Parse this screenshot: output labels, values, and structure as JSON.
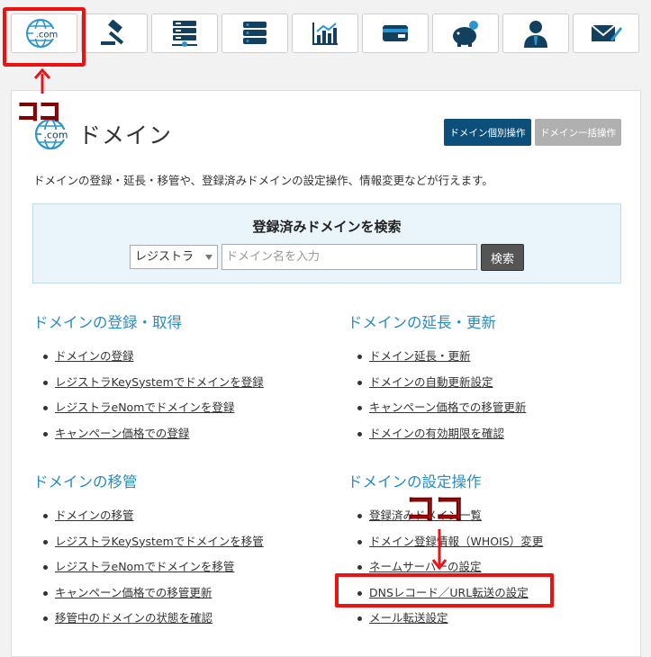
{
  "tabs": [
    {
      "name": "domain-tab",
      "icon": "dotcom-globe-icon"
    },
    {
      "name": "auction-tab",
      "icon": "gavel-icon"
    },
    {
      "name": "server-tab",
      "icon": "server-icon"
    },
    {
      "name": "storage-tab",
      "icon": "storage-stack-icon"
    },
    {
      "name": "analytics-tab",
      "icon": "chart-icon"
    },
    {
      "name": "payment-tab",
      "icon": "card-icon"
    },
    {
      "name": "points-tab",
      "icon": "piggy-bank-icon"
    },
    {
      "name": "account-tab",
      "icon": "person-icon"
    },
    {
      "name": "mail-tab",
      "icon": "mail-icon"
    }
  ],
  "tab_globe_label": ".com",
  "annotations": {
    "koko": "ココ"
  },
  "colors": {
    "link_heading": "#2a8cc0",
    "primary_button": "#0d4f7b",
    "disabled_button": "#b0b0b0",
    "highlight": "#ee1111"
  },
  "page": {
    "title_icon_label": ".com",
    "title": "ドメイン",
    "btn_individual": "ドメイン個別操作",
    "btn_bulk": "ドメイン一括操作",
    "description": "ドメインの登録・延長・移管や、登録済みドメインの設定操作、情報変更などが行えます。"
  },
  "search": {
    "title": "登録済みドメインを検索",
    "registrar_selected": "レジストラ",
    "placeholder": "ドメイン名を入力",
    "button": "検索"
  },
  "sections": {
    "register": {
      "heading": "ドメインの登録・取得",
      "items": [
        "ドメインの登録",
        "レジストラKeySystemでドメインを登録",
        "レジストラeNomでドメインを登録",
        "キャンペーン価格での登録"
      ]
    },
    "renew": {
      "heading": "ドメインの延長・更新",
      "items": [
        "ドメイン延長・更新",
        "ドメインの自動更新設定",
        "キャンペーン価格での移管更新",
        "ドメインの有効期限を確認"
      ]
    },
    "transfer": {
      "heading": "ドメインの移管",
      "items": [
        "ドメインの移管",
        "レジストラKeySystemでドメインを移管",
        "レジストラeNomでドメインを移管",
        "キャンペーン価格での移管更新",
        "移管中のドメインの状態を確認"
      ]
    },
    "settings": {
      "heading": "ドメインの設定操作",
      "items": [
        "登録済みドメイン一覧",
        "ドメイン登録情報（WHOIS）変更",
        "ネームサーバーの設定",
        "DNSレコード／URL転送の設定",
        "メール転送設定"
      ]
    }
  }
}
